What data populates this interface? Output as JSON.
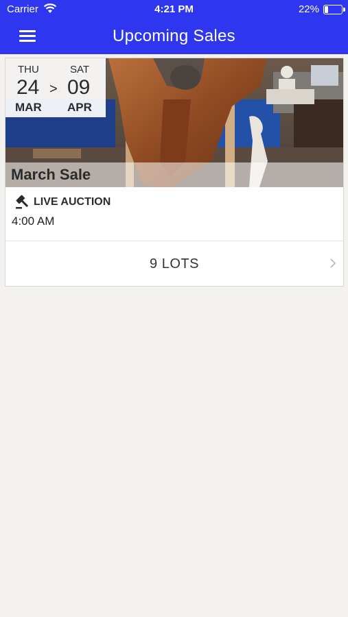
{
  "status_bar": {
    "carrier": "Carrier",
    "time": "4:21 PM",
    "battery_percent": "22%",
    "battery_level": 0.22
  },
  "nav": {
    "title": "Upcoming Sales",
    "menu_icon": "hamburger-menu-icon"
  },
  "colors": {
    "accent": "#2f36f0",
    "background": "#f3f2ef"
  },
  "sale": {
    "start": {
      "day_of_week": "THU",
      "day": "24",
      "month": "MAR"
    },
    "separator": ">",
    "end": {
      "day_of_week": "SAT",
      "day": "09",
      "month": "APR"
    },
    "name": "March Sale",
    "auction_icon": "gavel-icon",
    "auction_type": "LIVE AUCTION",
    "start_time": "4:00 AM",
    "lots_label": "9 LOTS",
    "lots_icon": "chevron-right-icon"
  }
}
